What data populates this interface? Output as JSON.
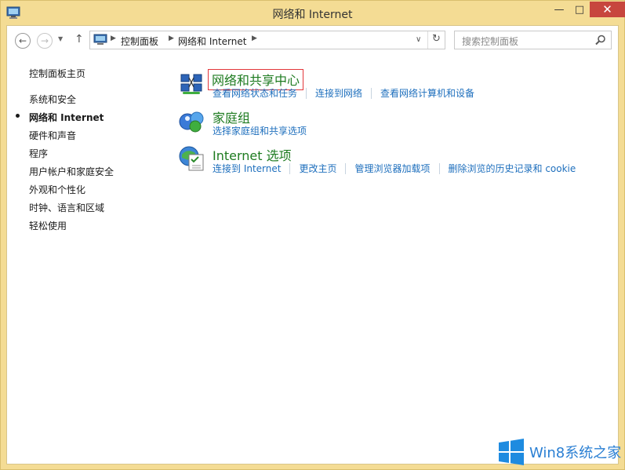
{
  "window": {
    "title": "网络和 Internet"
  },
  "controls": {
    "minimize": "—",
    "maximize": "□",
    "close": "✕"
  },
  "nav": {
    "back": "←",
    "forward": "→",
    "dropdown": "▼",
    "up": "↑"
  },
  "address": {
    "crumbs": [
      "控制面板",
      "网络和 Internet"
    ],
    "separator": "▶",
    "dropdown": "∨",
    "refresh": "↻"
  },
  "search": {
    "placeholder": "搜索控制面板"
  },
  "sidebar": {
    "items": [
      {
        "label": "控制面板主页"
      },
      {
        "label": "系统和安全"
      },
      {
        "label": "网络和 Internet",
        "active": true
      },
      {
        "label": "硬件和声音"
      },
      {
        "label": "程序"
      },
      {
        "label": "用户帐户和家庭安全"
      },
      {
        "label": "外观和个性化"
      },
      {
        "label": "时钟、语言和区域"
      },
      {
        "label": "轻松使用"
      }
    ]
  },
  "categories": [
    {
      "title": "网络和共享中心",
      "icon": "network-sharing-icon",
      "links": [
        "查看网络状态和任务",
        "连接到网络",
        "查看网络计算机和设备"
      ]
    },
    {
      "title": "家庭组",
      "icon": "homegroup-icon",
      "links": [
        "选择家庭组和共享选项"
      ]
    },
    {
      "title": "Internet 选项",
      "icon": "internet-options-icon",
      "links": [
        "连接到 Internet",
        "更改主页",
        "管理浏览器加载项",
        "删除浏览的历史记录和 cookie"
      ]
    }
  ],
  "watermark": {
    "text": "Win8系统之家"
  },
  "colors": {
    "link": "#1e6fbd",
    "category": "#1e7b20",
    "highlight": "#e3373b",
    "frame": "#f4dc94",
    "close": "#c7463e"
  }
}
